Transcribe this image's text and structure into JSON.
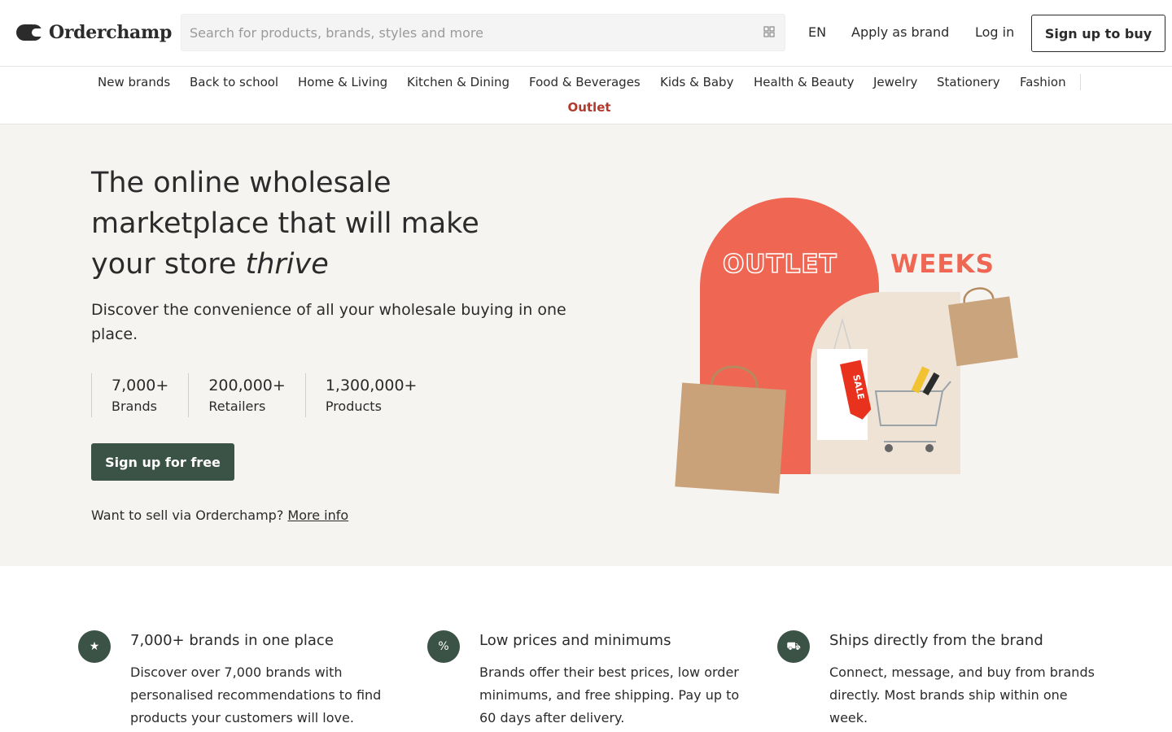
{
  "header": {
    "brand": "Orderchamp",
    "search_placeholder": "Search for products, brands, styles and more",
    "lang": "EN",
    "apply_label": "Apply as brand",
    "login_label": "Log in",
    "signup_label": "Sign up to buy"
  },
  "categories": [
    "New brands",
    "Back to school",
    "Home & Living",
    "Kitchen & Dining",
    "Food & Beverages",
    "Kids & Baby",
    "Health & Beauty",
    "Jewelry",
    "Stationery",
    "Fashion"
  ],
  "outlet_label": "Outlet",
  "hero": {
    "title_line1": "The online wholesale",
    "title_line2": "marketplace that will make",
    "title_line3_start": "your store ",
    "title_emphasis": "thrive",
    "subtitle": "Discover the convenience of all your wholesale buying in one place.",
    "stats": [
      {
        "value": "7,000+",
        "label": "Brands"
      },
      {
        "value": "200,000+",
        "label": "Retailers"
      },
      {
        "value": "1,300,000+",
        "label": "Products"
      }
    ],
    "cta_label": "Sign up for free",
    "sell_text": "Want to sell via Orderchamp?",
    "sell_link": "More info",
    "visual": {
      "word1": "OUTLET",
      "word2": "WEEKS",
      "tag_text": "SALE"
    }
  },
  "features": [
    {
      "title": "7,000+ brands in one place",
      "text": "Discover over 7,000 brands with personalised recommendations to find products your customers will love.",
      "icon": "star-icon"
    },
    {
      "title": "Low prices and minimums",
      "text": "Brands offer their best prices, low order minimums, and free shipping. Pay up to 60 days after delivery.",
      "icon": "tag-icon"
    },
    {
      "title": "Ships directly from the brand",
      "text": "Connect, message, and buy from brands directly. Most brands ship within one week.",
      "icon": "truck-icon"
    }
  ],
  "colors": {
    "accent_green": "#3b5246",
    "outlet_red": "#b03a2e",
    "hero_bg": "#f6f4f1",
    "promo_red": "#ef6653"
  }
}
